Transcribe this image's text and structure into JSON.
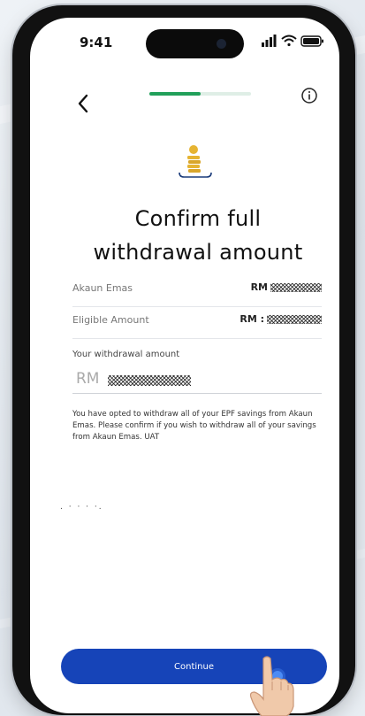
{
  "status_bar": {
    "time": "9:41"
  },
  "header": {
    "progress_fraction": 0.5
  },
  "title": {
    "line1": "Confirm full",
    "line2": "withdrawal amount"
  },
  "rows": [
    {
      "label": "Akaun Emas",
      "prefix": "RM"
    },
    {
      "label": "Eligible Amount",
      "prefix": "RM :"
    }
  ],
  "withdrawal": {
    "label": "Your withdrawal amount",
    "prefix": "RM"
  },
  "note": "You have opted to withdraw all of your EPF savings from Akaun Emas. Please confirm if you wish to withdraw all of your savings from Akaun Emas. UAT",
  "dots": ". · ·  ·            ·.",
  "buttons": {
    "continue": "Continue"
  },
  "colors": {
    "primary": "#1644b8",
    "progress": "#21a05a",
    "coin": "#e6b432"
  },
  "icons": [
    "back-arrow-icon",
    "info-icon",
    "coin-stack-icon",
    "signal-icon",
    "wifi-icon",
    "battery-icon",
    "hand-pointer-icon"
  ]
}
